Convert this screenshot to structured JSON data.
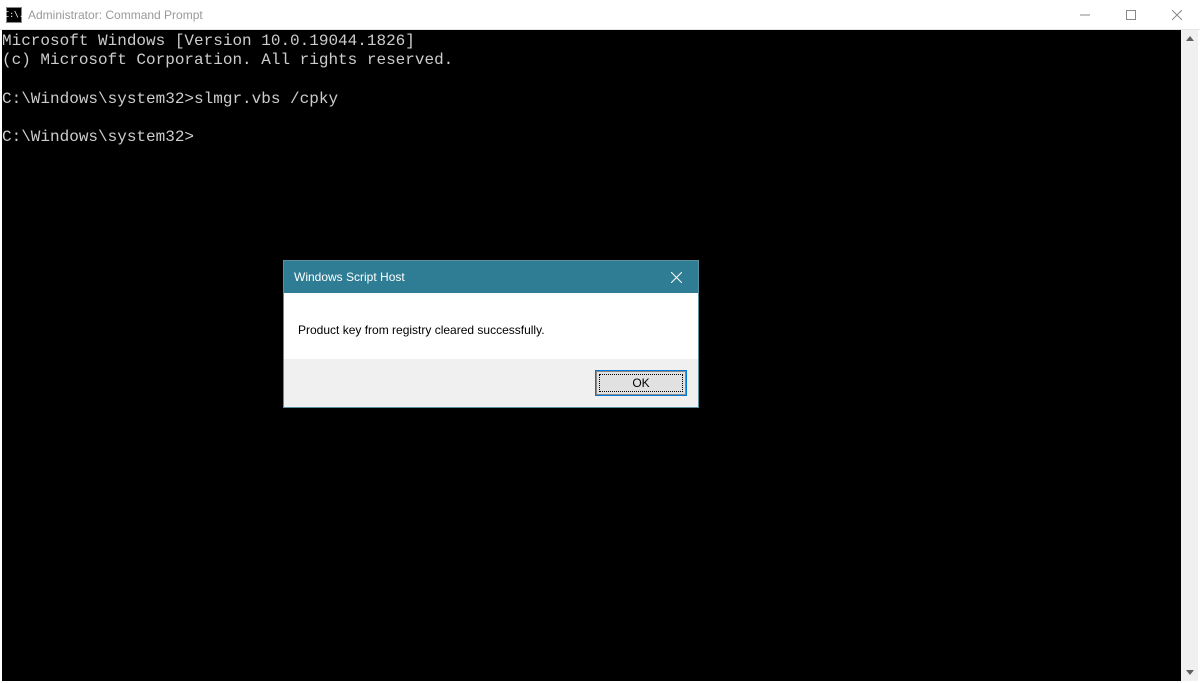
{
  "window": {
    "title": "Administrator: Command Prompt",
    "icon_text": "C:\\."
  },
  "console": {
    "lines": [
      "Microsoft Windows [Version 10.0.19044.1826]",
      "(c) Microsoft Corporation. All rights reserved.",
      "",
      "C:\\Windows\\system32>slmgr.vbs /cpky",
      "",
      "C:\\Windows\\system32>"
    ]
  },
  "dialog": {
    "title": "Windows Script Host",
    "message": "Product key from registry cleared successfully.",
    "ok_label": "OK"
  }
}
